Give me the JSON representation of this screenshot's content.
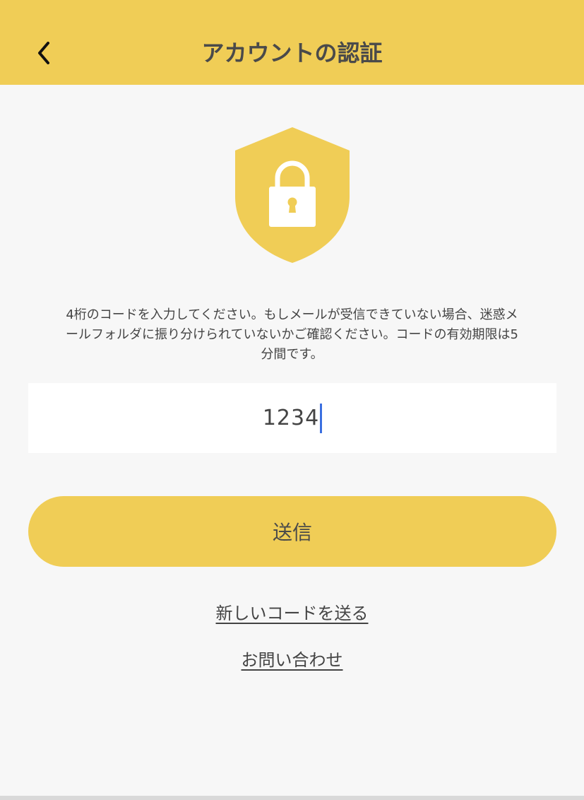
{
  "header": {
    "title": "アカウントの認証",
    "back_icon": "chevron-left-icon"
  },
  "shield": {
    "icon": "shield-lock-icon",
    "color": "#f0cd56"
  },
  "message": {
    "line1": "4桁のコードを入力してください。もしメールが受信できていない場合、迷惑メ",
    "line2": "ールフォルダに振り分けられていないかご確認ください。コードの有効期限は5",
    "line3": "分間です。"
  },
  "code_input": {
    "value": "1234"
  },
  "submit": {
    "label": "送信"
  },
  "links": {
    "resend": "新しいコードを送る",
    "contact": "お問い合わせ"
  },
  "colors": {
    "accent": "#f0cd56",
    "caret": "#3b6fe0",
    "background": "#f7f7f7"
  }
}
